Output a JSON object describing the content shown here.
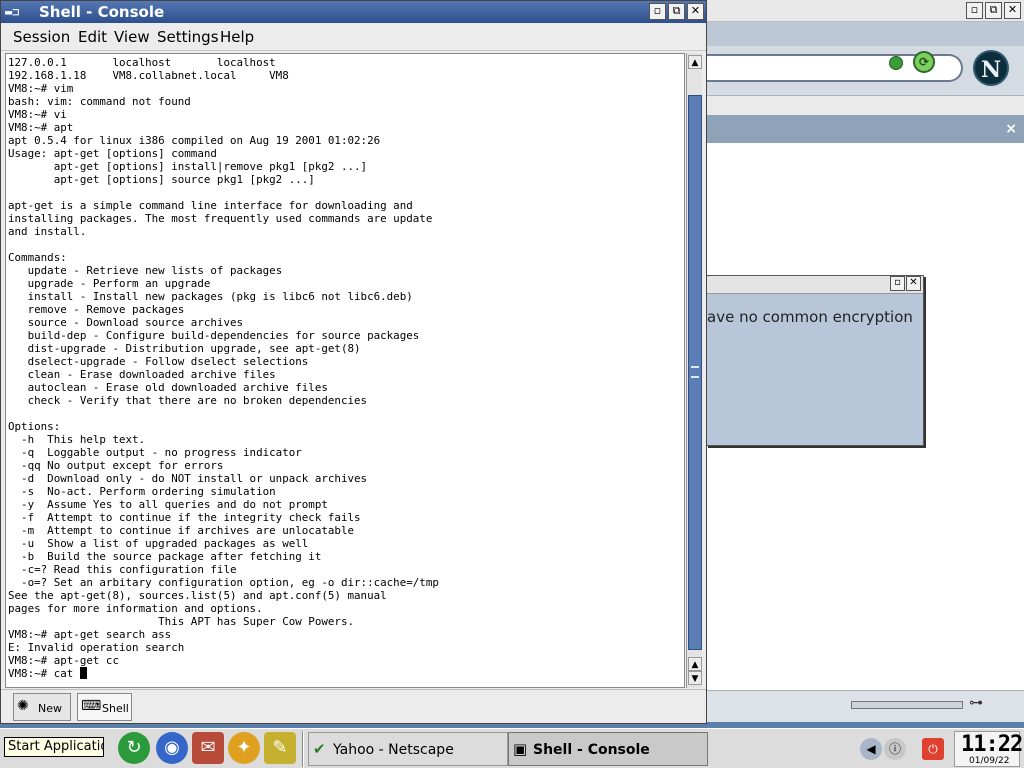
{
  "netscape": {
    "sidebar_close": "×",
    "logo": "N",
    "dialog_text": "ave no common encryption"
  },
  "window_buttons": {
    "minimize": "▫",
    "maximize": "⧉",
    "close": "✕"
  },
  "konsole": {
    "title": "Shell - Console",
    "menu": [
      "Session",
      "Edit",
      "View",
      "Settings",
      "Help"
    ],
    "terminal_lines": [
      "127.0.0.1       localhost       localhost",
      "192.168.1.18    VM8.collabnet.local     VM8",
      "VM8:~# vim",
      "bash: vim: command not found",
      "VM8:~# vi",
      "VM8:~# apt",
      "apt 0.5.4 for linux i386 compiled on Aug 19 2001 01:02:26",
      "Usage: apt-get [options] command",
      "       apt-get [options] install|remove pkg1 [pkg2 ...]",
      "       apt-get [options] source pkg1 [pkg2 ...]",
      "",
      "apt-get is a simple command line interface for downloading and",
      "installing packages. The most frequently used commands are update",
      "and install.",
      "",
      "Commands:",
      "   update - Retrieve new lists of packages",
      "   upgrade - Perform an upgrade",
      "   install - Install new packages (pkg is libc6 not libc6.deb)",
      "   remove - Remove packages",
      "   source - Download source archives",
      "   build-dep - Configure build-dependencies for source packages",
      "   dist-upgrade - Distribution upgrade, see apt-get(8)",
      "   dselect-upgrade - Follow dselect selections",
      "   clean - Erase downloaded archive files",
      "   autoclean - Erase old downloaded archive files",
      "   check - Verify that there are no broken dependencies",
      "",
      "Options:",
      "  -h  This help text.",
      "  -q  Loggable output - no progress indicator",
      "  -qq No output except for errors",
      "  -d  Download only - do NOT install or unpack archives",
      "  -s  No-act. Perform ordering simulation",
      "  -y  Assume Yes to all queries and do not prompt",
      "  -f  Attempt to continue if the integrity check fails",
      "  -m  Attempt to continue if archives are unlocatable",
      "  -u  Show a list of upgraded packages as well",
      "  -b  Build the source package after fetching it",
      "  -c=? Read this configuration file",
      "  -o=? Set an arbitary configuration option, eg -o dir::cache=/tmp",
      "See the apt-get(8), sources.list(5) and apt.conf(5) manual",
      "pages for more information and options.",
      "                       This APT has Super Cow Powers.",
      "VM8:~# apt-get search ass",
      "E: Invalid operation search",
      "VM8:~# apt-get cc"
    ],
    "prompt_line": "VM8:~# cat ",
    "tabs": [
      {
        "label": "New",
        "icon": "new-session-icon"
      },
      {
        "label": "Shell",
        "icon": "shell-icon"
      }
    ],
    "scroll_up": "▲",
    "scroll_down": "▼"
  },
  "taskbar": {
    "start_tooltip": "Start Application",
    "tasks": [
      {
        "label": "Yahoo - Netscape",
        "icon": "netscape-icon",
        "active": false
      },
      {
        "label": "Shell - Console",
        "icon": "console-icon",
        "active": true
      }
    ],
    "clock_time": "11:22",
    "clock_date": "01/09/22"
  }
}
